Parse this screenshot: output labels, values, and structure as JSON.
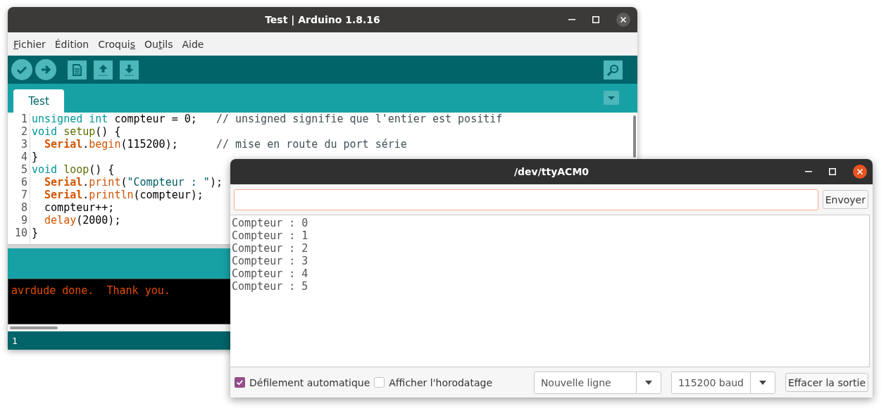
{
  "ide": {
    "title": "Test | Arduino 1.8.16",
    "menu": [
      {
        "key": "F",
        "post": "ichier"
      },
      {
        "pre": "Édition"
      },
      {
        "pre": "Croqui",
        "key": "s"
      },
      {
        "pre": "Ou",
        "key": "t",
        "post": "ils"
      },
      {
        "pre": "Aide"
      }
    ],
    "tabs": [
      {
        "label": "Test",
        "selected": true
      }
    ],
    "code": [
      {
        "num": "1",
        "tokens": [
          {
            "kind": "keyword",
            "text": "unsigned"
          },
          {
            "kind": "keyword",
            "text": " int"
          },
          {
            "kind": "plain",
            "text": " compteur = 0;   "
          },
          {
            "kind": "comment",
            "text": "// unsigned signifie que l'entier est positif"
          }
        ]
      },
      {
        "num": "2",
        "tokens": [
          {
            "kind": "keyword",
            "text": "void"
          },
          {
            "kind": "function",
            "text": " setup"
          },
          {
            "kind": "plain",
            "text": "() {"
          }
        ]
      },
      {
        "num": "3",
        "tokens": [
          {
            "kind": "class",
            "text": "  Serial"
          },
          {
            "kind": "plain",
            "text": "."
          },
          {
            "kind": "method",
            "text": "begin"
          },
          {
            "kind": "plain",
            "text": "(115200);      "
          },
          {
            "kind": "comment",
            "text": "// mise en route du port série"
          }
        ]
      },
      {
        "num": "4",
        "tokens": [
          {
            "kind": "plain",
            "text": "}"
          }
        ]
      },
      {
        "num": "5",
        "tokens": [
          {
            "kind": "keyword",
            "text": "void"
          },
          {
            "kind": "function",
            "text": " loop"
          },
          {
            "kind": "plain",
            "text": "() {"
          }
        ]
      },
      {
        "num": "6",
        "tokens": [
          {
            "kind": "class",
            "text": "  Serial"
          },
          {
            "kind": "plain",
            "text": "."
          },
          {
            "kind": "method",
            "text": "print"
          },
          {
            "kind": "plain",
            "text": "("
          },
          {
            "kind": "string",
            "text": "\"Compteur : \""
          },
          {
            "kind": "plain",
            "text": ");"
          }
        ]
      },
      {
        "num": "7",
        "tokens": [
          {
            "kind": "class",
            "text": "  Serial"
          },
          {
            "kind": "plain",
            "text": "."
          },
          {
            "kind": "method",
            "text": "println"
          },
          {
            "kind": "plain",
            "text": "(compteur);"
          }
        ]
      },
      {
        "num": "8",
        "tokens": [
          {
            "kind": "plain",
            "text": "  compteur++;"
          }
        ]
      },
      {
        "num": "9",
        "tokens": [
          {
            "kind": "method",
            "text": "  delay"
          },
          {
            "kind": "plain",
            "text": "(2000);"
          }
        ]
      },
      {
        "num": "10",
        "tokens": [
          {
            "kind": "plain",
            "text": "}"
          }
        ]
      }
    ],
    "console": [
      "avrdude done.  Thank you."
    ],
    "status_line": "1"
  },
  "serial": {
    "title": "/dev/ttyACM0",
    "send_button": "Envoyer",
    "output": [
      "Compteur : 0",
      "Compteur : 1",
      "Compteur : 2",
      "Compteur : 3",
      "Compteur : 4",
      "Compteur : 5"
    ],
    "options": [
      {
        "label": "Défilement automatique",
        "checked": true
      },
      {
        "label": "Afficher l'horodatage",
        "checked": false
      }
    ],
    "line_ending": "Nouvelle ligne",
    "baud": "115200 baud",
    "clear_button": "Effacer la sortie"
  }
}
